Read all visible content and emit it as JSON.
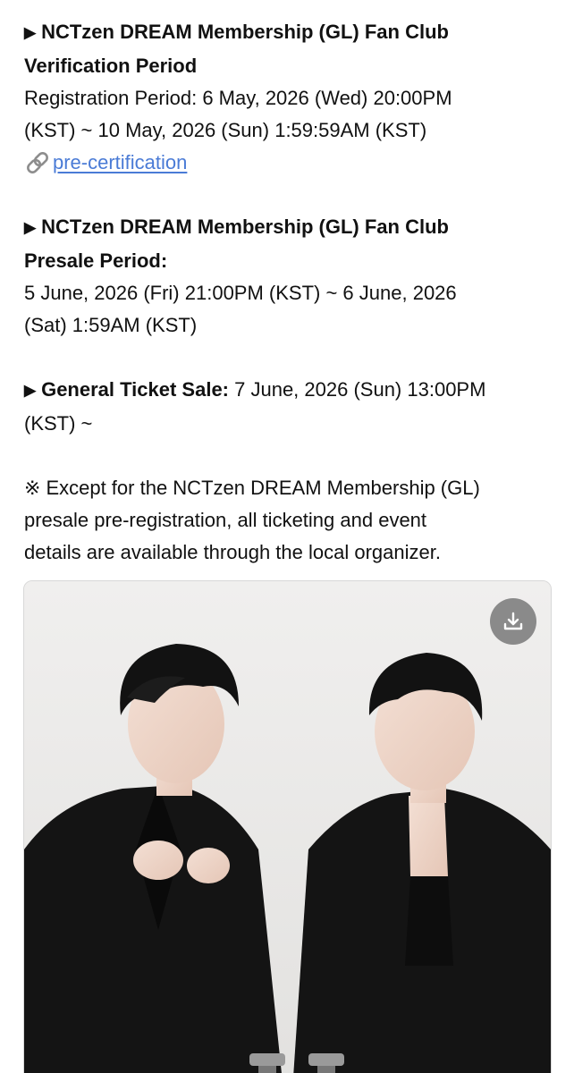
{
  "sections": {
    "verification": {
      "arrow": "▶",
      "heading_line1": "NCTzen DREAM Membership (GL) Fan Club",
      "heading_line2": "Verification Period",
      "body_line1": "Registration Period: 6 May, 2026 (Wed) 20:00PM",
      "body_line2": "(KST) ~ 10 May, 2026 (Sun) 1:59:59AM (KST)",
      "link_label": "pre-certification",
      "link_icon": "link-icon"
    },
    "presale": {
      "arrow": "▶",
      "heading_line1": "NCTzen DREAM Membership (GL) Fan Club",
      "heading_line2": "Presale Period:",
      "body_line1": "5 June, 2026 (Fri) 21:00PM (KST) ~ 6 June, 2026",
      "body_line2": "(Sat) 1:59AM (KST)"
    },
    "general": {
      "arrow": "▶",
      "label": "General Ticket Sale:",
      "body_line1": " 7 June, 2026 (Sun) 13:00PM",
      "body_line2": "(KST) ~"
    },
    "note": {
      "mark": "※",
      "line1": "Except for the NCTzen DREAM Membership (GL)",
      "line2": "presale pre-registration, all ticketing and event",
      "line3": "details are available through the local organizer."
    }
  },
  "image": {
    "alt": "Two people in black suits seated against a light grey backdrop",
    "download_icon": "download-icon"
  },
  "colors": {
    "link": "#4a7bd6",
    "text": "#111111",
    "photo_bg": "#ecebea",
    "suit": "#141414"
  }
}
